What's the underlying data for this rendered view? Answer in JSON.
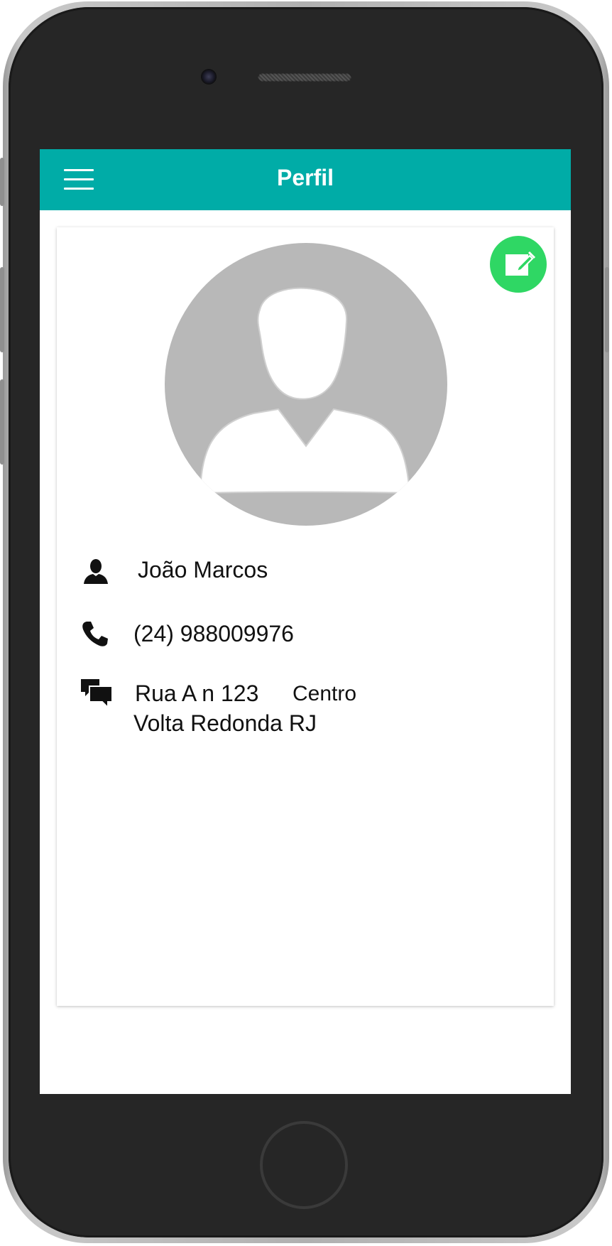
{
  "appbar": {
    "title": "Perfil",
    "menu_icon": "hamburger-menu-icon"
  },
  "profile": {
    "edit_icon": "edit-pencil-icon",
    "avatar_icon": "default-user-avatar",
    "name_icon": "person-icon",
    "name": "João Marcos",
    "phone_icon": "phone-icon",
    "phone": "(24) 988009976",
    "address_icon": "chat-bubbles-icon",
    "street": "Rua A n 123",
    "district": "Centro",
    "city": "Volta Redonda RJ"
  },
  "colors": {
    "appbar": "#00aca7",
    "fab": "#2fd764",
    "avatar_bg": "#b8b8b8"
  }
}
